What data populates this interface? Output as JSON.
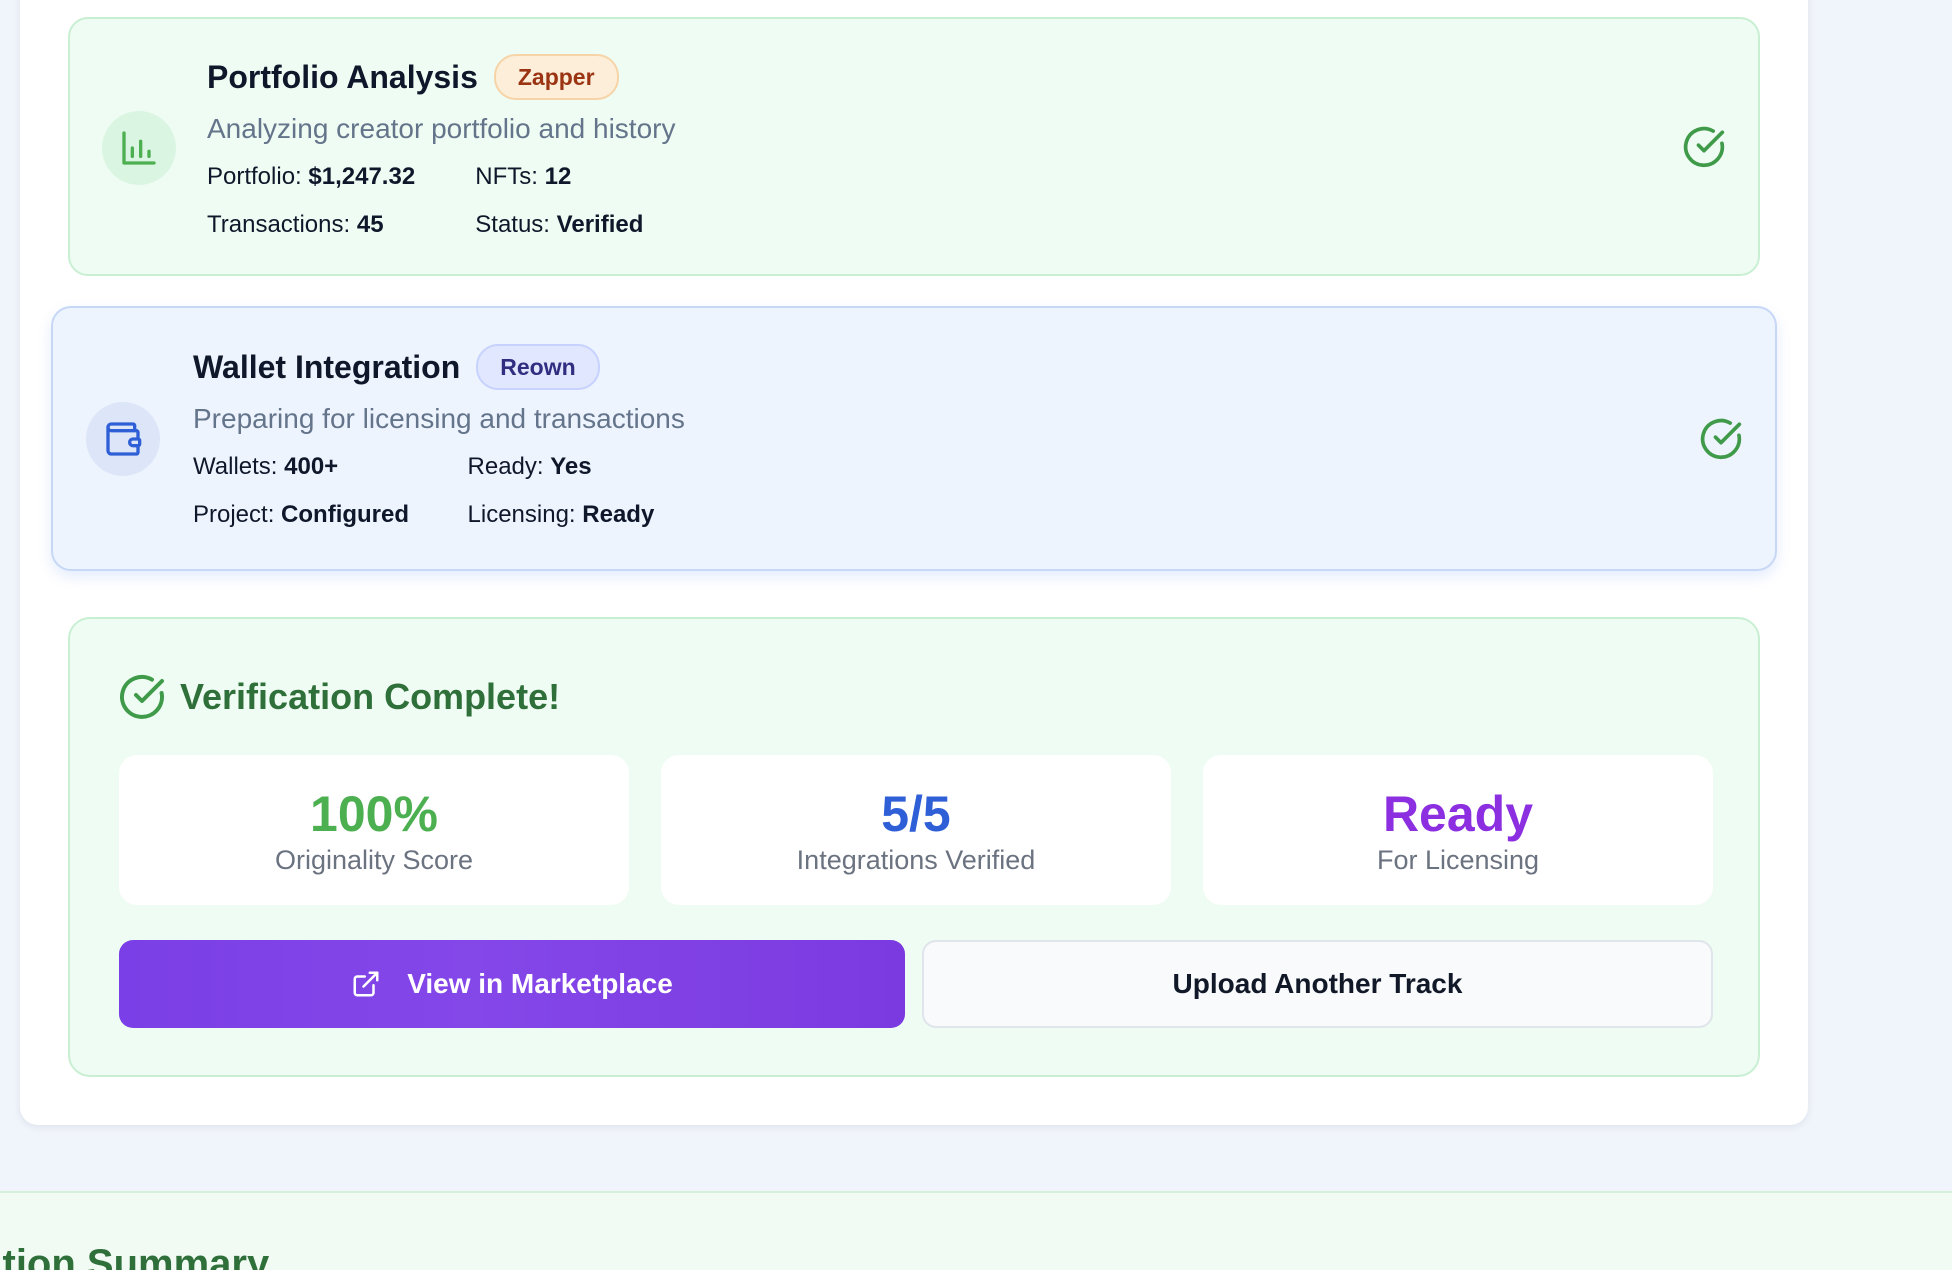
{
  "steps": [
    {
      "title": "Portfolio Analysis",
      "badge": "Zapper",
      "description": "Analyzing creator portfolio and history",
      "icon": "bar-chart-icon",
      "stats": [
        {
          "label": "Portfolio:",
          "value": "$1,247.32"
        },
        {
          "label": "NFTs:",
          "value": "12"
        },
        {
          "label": "Transactions:",
          "value": "45"
        },
        {
          "label": "Status:",
          "value": "Verified"
        }
      ],
      "status_icon": "check-circle-icon"
    },
    {
      "title": "Wallet Integration",
      "badge": "Reown",
      "description": "Preparing for licensing and transactions",
      "icon": "wallet-icon",
      "stats": [
        {
          "label": "Wallets:",
          "value": "400+"
        },
        {
          "label": "Ready:",
          "value": "Yes"
        },
        {
          "label": "Project:",
          "value": "Configured"
        },
        {
          "label": "Licensing:",
          "value": "Ready"
        }
      ],
      "status_icon": "check-circle-icon"
    }
  ],
  "complete": {
    "title": "Verification Complete!",
    "metrics": [
      {
        "value": "100%",
        "label": "Originality Score"
      },
      {
        "value": "5/5",
        "label": "Integrations Verified"
      },
      {
        "value": "Ready",
        "label": "For Licensing"
      }
    ],
    "primary_button": "View in Marketplace",
    "secondary_button": "Upload Another Track"
  },
  "summary": {
    "title": "cation Summary"
  },
  "colors": {
    "green": "#4caf50",
    "blue": "#2f5fd6",
    "purple": "#8b2fe0",
    "primary_button": "#7b3ae0"
  }
}
